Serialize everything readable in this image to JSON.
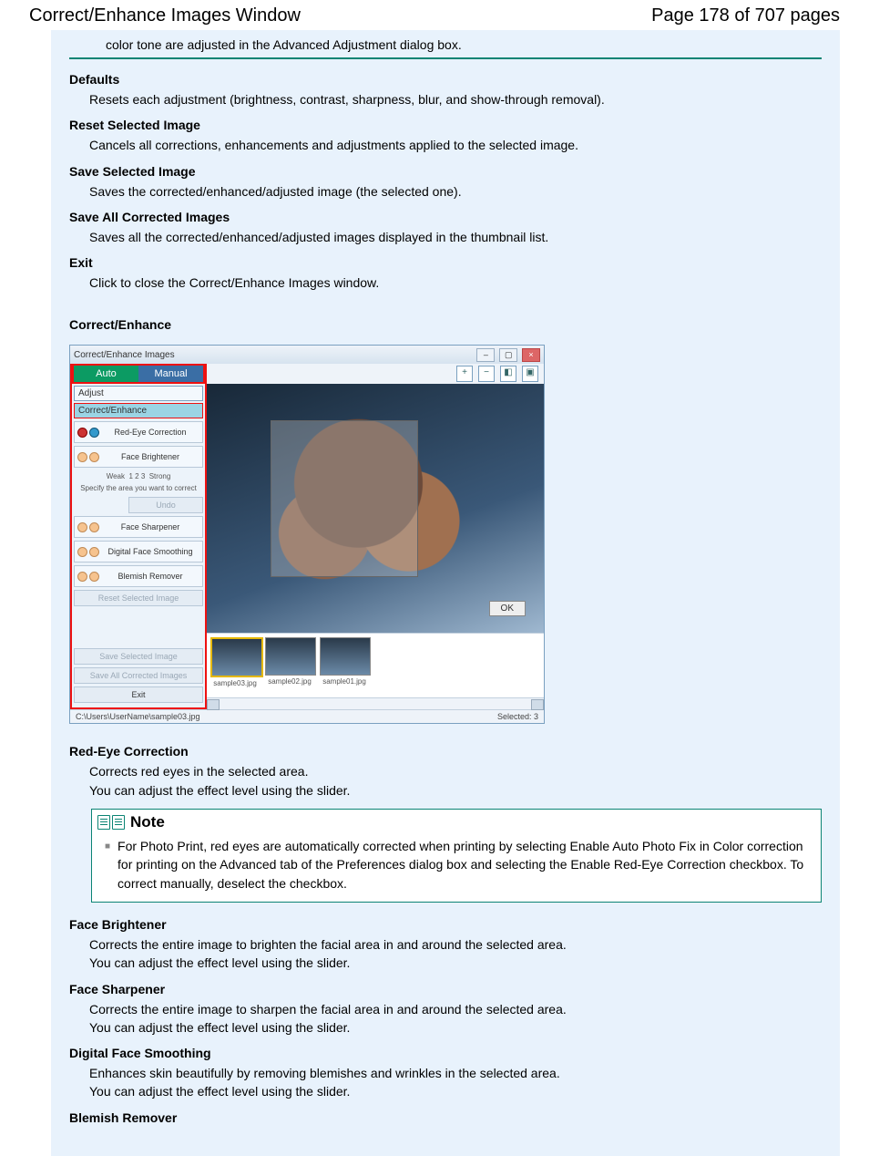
{
  "header": {
    "title": "Correct/Enhance Images Window",
    "page_indicator": "Page 178 of 707 pages"
  },
  "frag_line": "color tone are adjusted in the Advanced Adjustment dialog box.",
  "items": [
    {
      "term": "Defaults",
      "desc": "Resets each adjustment (brightness, contrast, sharpness, blur, and show-through removal)."
    },
    {
      "term": "Reset Selected Image",
      "desc": "Cancels all corrections, enhancements and adjustments applied to the selected image."
    },
    {
      "term": "Save Selected Image",
      "desc": "Saves the corrected/enhanced/adjusted image (the selected one)."
    },
    {
      "term": "Save All Corrected Images",
      "desc": "Saves all the corrected/enhanced/adjusted images displayed in the thumbnail list."
    },
    {
      "term": "Exit",
      "desc": "Click to close the Correct/Enhance Images window."
    }
  ],
  "correct_enhance_heading": "Correct/Enhance",
  "screenshot": {
    "title": "Correct/Enhance Images",
    "tabs": {
      "auto": "Auto",
      "manual": "Manual"
    },
    "subtabs": {
      "adjust": "Adjust",
      "enhance": "Correct/Enhance"
    },
    "tools": {
      "redeye": "Red-Eye Correction",
      "brightener": "Face Brightener",
      "sharpener": "Face Sharpener",
      "smoothing": "Digital Face Smoothing",
      "blemish": "Blemish Remover"
    },
    "slider": {
      "weak": "Weak",
      "marks": "1  2  3",
      "strong": "Strong",
      "hint": "Specify the area you want to correct",
      "undo": "Undo"
    },
    "buttons": {
      "reset": "Reset Selected Image",
      "save_sel": "Save Selected Image",
      "save_all": "Save All Corrected Images",
      "exit": "Exit",
      "ok": "OK"
    },
    "thumbs": [
      "sample03.jpg",
      "sample02.jpg",
      "sample01.jpg"
    ],
    "status": {
      "path": "C:\\Users\\UserName\\sample03.jpg",
      "selected": "Selected: 3"
    }
  },
  "after": [
    {
      "term": "Red-Eye Correction",
      "desc": "Corrects red eyes in the selected area.\nYou can adjust the effect level using the slider."
    }
  ],
  "note": {
    "label": "Note",
    "text": "For Photo Print, red eyes are automatically corrected when printing by selecting Enable Auto Photo Fix in Color correction for printing on the Advanced tab of the Preferences dialog box and selecting the Enable Red-Eye Correction checkbox. To correct manually, deselect the checkbox."
  },
  "after2": [
    {
      "term": "Face Brightener",
      "desc": "Corrects the entire image to brighten the facial area in and around the selected area.\nYou can adjust the effect level using the slider."
    },
    {
      "term": "Face Sharpener",
      "desc": "Corrects the entire image to sharpen the facial area in and around the selected area.\nYou can adjust the effect level using the slider."
    },
    {
      "term": "Digital Face Smoothing",
      "desc": "Enhances skin beautifully by removing blemishes and wrinkles in the selected area.\nYou can adjust the effect level using the slider."
    },
    {
      "term": "Blemish Remover",
      "desc": ""
    }
  ]
}
